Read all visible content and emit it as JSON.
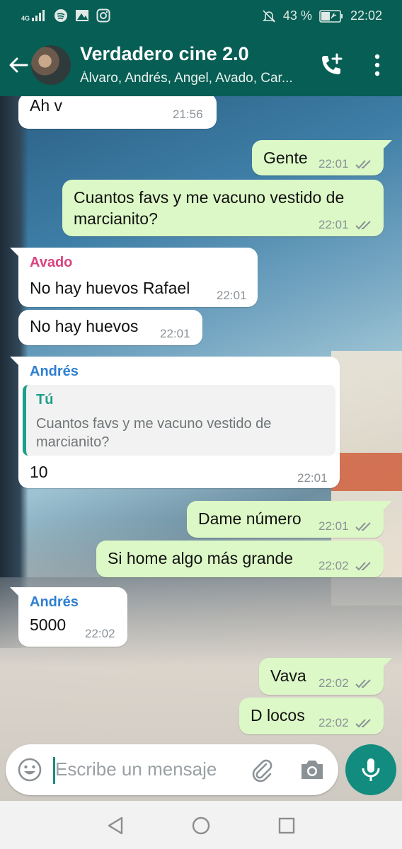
{
  "status_bar": {
    "network": "4G",
    "battery": "43 %",
    "time": "22:02",
    "icons": [
      "signal-icon",
      "spotify-icon",
      "gallery-icon",
      "instagram-icon",
      "mute-icon",
      "battery-icon"
    ]
  },
  "header": {
    "title": "Verdadero cine 2.0",
    "subtitle": "Álvaro, Andrés, Angel, Avado, Car..."
  },
  "messages": [
    {
      "type": "in",
      "text": "Ah v",
      "time": "21:56"
    },
    {
      "type": "out",
      "text": "Gente",
      "time": "22:01"
    },
    {
      "type": "out",
      "lines": [
        "Cuantos favs y me vacuno vestido de",
        "marcianito?"
      ],
      "time": "22:01"
    },
    {
      "type": "in",
      "sender": "Avado",
      "text": "No hay huevos Rafael",
      "time": "22:01"
    },
    {
      "type": "in",
      "text": "No hay huevos",
      "time": "22:01"
    },
    {
      "type": "in",
      "sender": "Andrés",
      "quote_name": "Tú",
      "quote_text": "Cuantos favs y me vacuno vestido de marcianito?",
      "text": "10",
      "time": "22:01"
    },
    {
      "type": "out",
      "text": "Dame número",
      "time": "22:01"
    },
    {
      "type": "out",
      "text": "Si home algo más grande",
      "time": "22:02"
    },
    {
      "type": "in",
      "sender": "Andrés",
      "text": "5000",
      "time": "22:02"
    },
    {
      "type": "out",
      "text": "Vava",
      "time": "22:02"
    },
    {
      "type": "out",
      "text": "D locos",
      "time": "22:02"
    }
  ],
  "input": {
    "placeholder": "Escribe un mensaje"
  },
  "colors": {
    "header": "#075e54",
    "outgoing_bubble": "#dcf8c6",
    "incoming_bubble": "#ffffff",
    "sender_avado": "#d9447e",
    "sender_andres": "#2f7fd0",
    "quote_accent": "#1f9e8a",
    "mic_button": "#128c7e",
    "read_ticks": "#8a9197"
  }
}
